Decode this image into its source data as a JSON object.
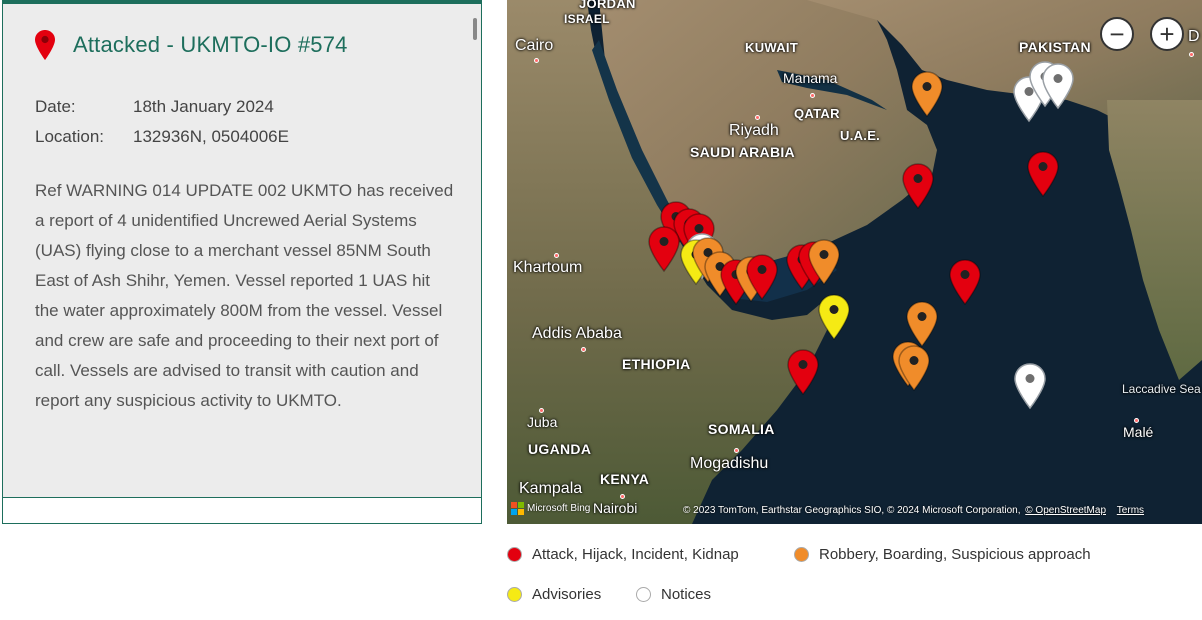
{
  "report": {
    "title": "Attacked - UKMTO-IO #574",
    "date_label": "Date:",
    "date_value": "18th January 2024",
    "location_label": "Location:",
    "location_value": "132936N, 0504006E",
    "description": "Ref WARNING 014 UPDATE 002 UKMTO has received a report of 4 unidentified Uncrewed Aerial Systems (UAS) flying close to a merchant vessel 85NM South East of Ash Shihr, Yemen. Vessel reported 1 UAS hit the water approximately 800M from the vessel. Vessel and crew are safe and proceeding to their next port of call. Vessels are advised to transit with caution and report any suspicious activity to UKMTO."
  },
  "map": {
    "labels": {
      "jordan": "JORDAN",
      "israel": "ISRAEL",
      "cairo": "Cairo",
      "kuwait": "KUWAIT",
      "pakistan": "PAKISTAN",
      "manama": "Manama",
      "qatar": "QATAR",
      "riyadh": "Riyadh",
      "uae": "U.A.E.",
      "saudi": "SAUDI ARABIA",
      "khartoum": "Khartoum",
      "addis": "Addis Ababa",
      "ethiopia": "ETHIOPIA",
      "laccadive": "Laccadive Sea",
      "juba": "Juba",
      "uganda": "UGANDA",
      "somalia": "SOMALIA",
      "male": "Malé",
      "kenya": "KENYA",
      "mogadishu": "Mogadishu",
      "kampala": "Kampala",
      "nairobi": "Nairobi",
      "edge_d": "D"
    },
    "zoom_out": "−",
    "zoom_in": "+",
    "bing": "Microsoft Bing",
    "attribution": "© 2023 TomTom, Earthstar Geographics SIO, © 2024 Microsoft Corporation,",
    "osm": "© OpenStreetMap",
    "terms": "Terms"
  },
  "legend": {
    "attack": {
      "label": "Attack, Hijack, Incident, Kidnap",
      "color": "#e3000f"
    },
    "robbery": {
      "label": "Robbery, Boarding, Suspicious approach",
      "color": "#f08c2a"
    },
    "advisory": {
      "label": "Advisories",
      "color": "#f5ea14"
    },
    "notice": {
      "label": "Notices",
      "color": "#ffffff"
    }
  }
}
